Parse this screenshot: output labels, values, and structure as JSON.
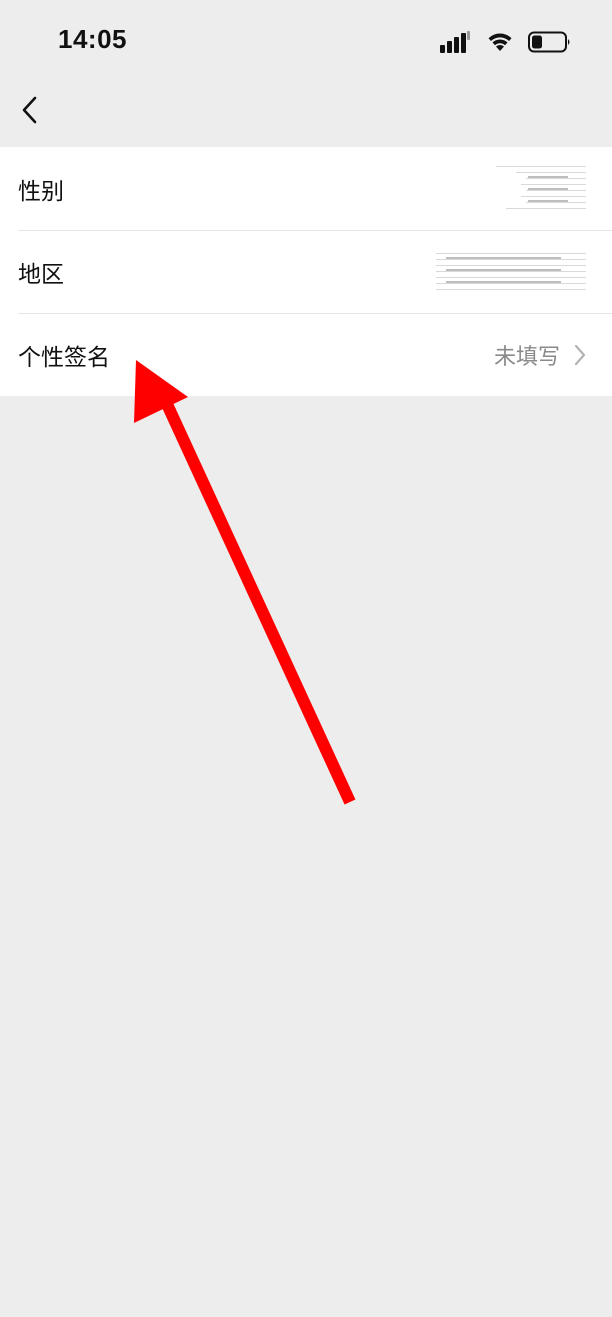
{
  "status_bar": {
    "time": "14:05"
  },
  "icons": {
    "back": "chevron-left-icon",
    "signal": "signal-bars-icon",
    "wifi": "wifi-icon",
    "battery": "battery-icon",
    "disclosure": "chevron-right-icon"
  },
  "settings": {
    "rows": [
      {
        "label": "性别",
        "value": ""
      },
      {
        "label": "地区",
        "value": ""
      },
      {
        "label": "个性签名",
        "value": "未填写"
      }
    ]
  },
  "colors": {
    "background": "#ededed",
    "row_background": "#ffffff",
    "value_text": "#8a8a8a",
    "annotation_arrow": "#ff0000"
  }
}
